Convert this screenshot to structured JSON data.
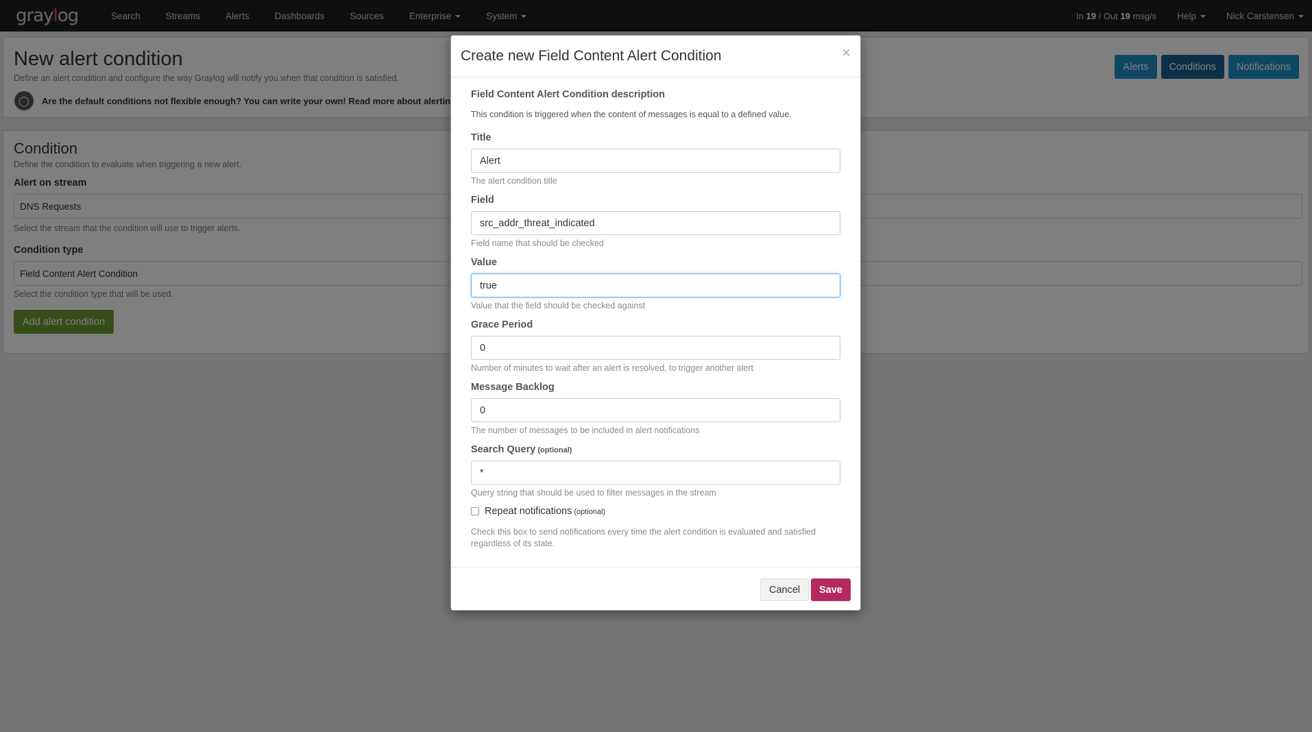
{
  "navbar": {
    "brand": "graylog",
    "links": [
      "Search",
      "Streams",
      "Alerts",
      "Dashboards",
      "Sources",
      "Enterprise",
      "System"
    ],
    "throughput": {
      "in_label": "In",
      "in_value": "19",
      "sep": "/ Out",
      "out_value": "19",
      "unit": "msg/s"
    },
    "help": "Help",
    "user": "Nick Carstensen"
  },
  "header": {
    "title": "New alert condition",
    "subtitle": "Define an alert condition and configure the way Graylog will notify you when that condition is satisfied.",
    "hint": "Are the default conditions not flexible enough? You can write your own! Read more about alerting in",
    "buttons": [
      "Alerts",
      "Conditions",
      "Notifications"
    ]
  },
  "condition": {
    "title": "Condition",
    "subtitle": "Define the condition to evaluate when triggering a new alert.",
    "stream_label": "Alert on stream",
    "stream_value": "DNS Requests",
    "stream_help": "Select the stream that the condition will use to trigger alerts.",
    "type_label": "Condition type",
    "type_value": "Field Content Alert Condition",
    "type_help": "Select the condition type that will be used.",
    "add_button": "Add alert condition"
  },
  "modal": {
    "title": "Create new Field Content Alert Condition",
    "close": "×",
    "desc_title": "Field Content Alert Condition description",
    "desc": "This condition is triggered when the content of messages is equal to a defined value.",
    "fields": {
      "title": {
        "label": "Title",
        "value": "Alert",
        "help": "The alert condition title"
      },
      "field": {
        "label": "Field",
        "value": "src_addr_threat_indicated",
        "help": "Field name that should be checked"
      },
      "value": {
        "label": "Value",
        "value": "true",
        "help": "Value that the field should be checked against"
      },
      "grace": {
        "label": "Grace Period",
        "value": "0",
        "help": "Number of minutes to wait after an alert is resolved, to trigger another alert"
      },
      "backlog": {
        "label": "Message Backlog",
        "value": "0",
        "help": "The number of messages to be included in alert notifications"
      },
      "query": {
        "label": "Search Query",
        "optional": "(optional)",
        "value": "*",
        "help": "Query string that should be used to filter messages in the stream"
      }
    },
    "repeat": {
      "label": "Repeat notifications",
      "optional": "(optional)",
      "help": "Check this box to send notifications every time the alert condition is evaluated and satisfied regardless of its state."
    },
    "cancel": "Cancel",
    "save": "Save"
  }
}
